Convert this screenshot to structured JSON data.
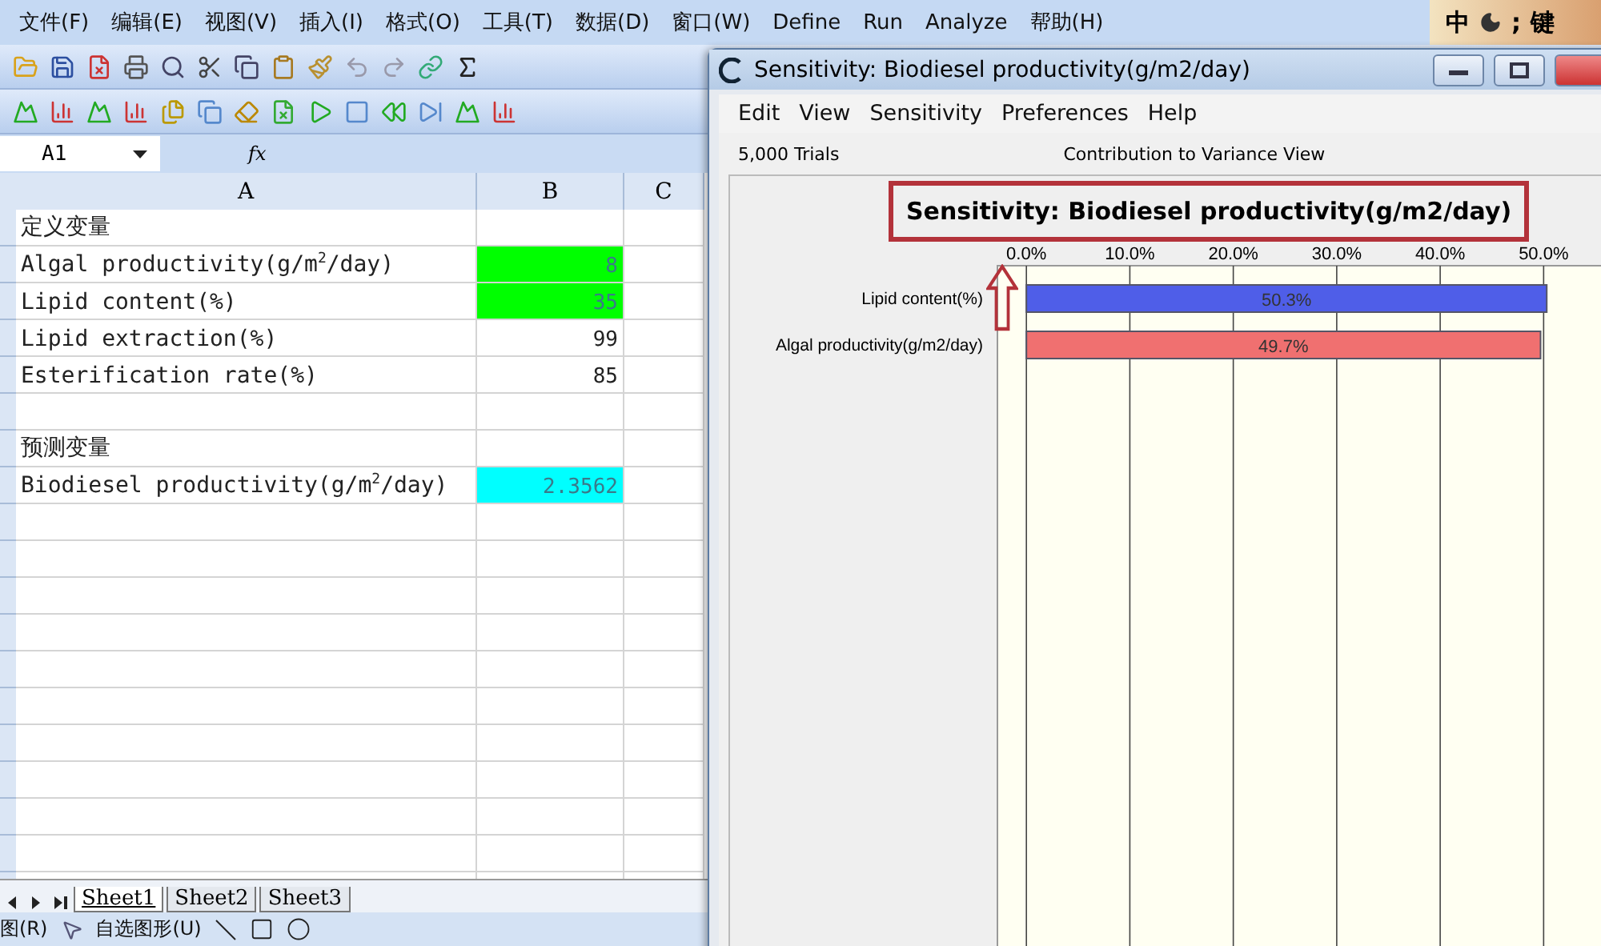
{
  "excel": {
    "menu": [
      "文件(F)",
      "编辑(E)",
      "视图(V)",
      "插入(I)",
      "格式(O)",
      "工具(T)",
      "数据(D)",
      "窗口(W)",
      "Define",
      "Run",
      "Analyze",
      "帮助(H)"
    ],
    "name_box": "A1",
    "formula_label": "fx",
    "columns": [
      "A",
      "B",
      "C"
    ],
    "rows": [
      {
        "a": "定义变量"
      },
      {
        "a": "Algal productivity(g/m$^{2}$/day)",
        "b": "8",
        "color": "#00ff00"
      },
      {
        "a": "Lipid content(%)",
        "b": "35",
        "color": "#00ff00"
      },
      {
        "a": "Lipid extraction(%)",
        "b": "99"
      },
      {
        "a": "Esterification rate(%)",
        "b": "85"
      },
      {},
      {
        "a": "预测变量"
      },
      {
        "a": "Biodiesel productivity(g/m$^{2}$/day)",
        "b": "2.3562",
        "color": "#00ffff"
      },
      {},
      {},
      {},
      {},
      {},
      {},
      {},
      {},
      {},
      {},
      {}
    ],
    "sheets": [
      {
        "label": "Sheet1",
        "selected": true
      },
      {
        "label": "Sheet2",
        "selected": false
      },
      {
        "label": "Sheet3",
        "selected": false
      }
    ],
    "draw_toolbar": [
      "图(R)",
      "自选图形(U)"
    ]
  },
  "ime": [
    "中",
    ";",
    "键"
  ],
  "sensitivity_window": {
    "title": "Sensitivity: Biodiesel productivity(g/m2/day)",
    "menu": [
      "Edit",
      "View",
      "Sensitivity",
      "Preferences",
      "Help"
    ],
    "trials": "5,000 Trials",
    "view": "Contribution to Variance View",
    "chart_data": {
      "type": "bar",
      "orientation": "horizontal",
      "title": "Sensitivity: Biodiesel productivity(g/m2/day)",
      "categories": [
        "Lipid content(%)",
        "Algal productivity(g/m2/day)"
      ],
      "series": [
        {
          "values": [
            50.3,
            49.7
          ]
        }
      ],
      "grid": true,
      "xlim": [
        -2.8,
        55.7
      ],
      "colors": [
        "#4f5ee8",
        "#f07070"
      ],
      "value_labels": [
        "50.3%",
        "49.7%"
      ],
      "xticks": [
        {
          "value": 0,
          "label": "0.0%"
        },
        {
          "value": 10,
          "label": "10.0%"
        },
        {
          "value": 20,
          "label": "20.0%"
        },
        {
          "value": 30,
          "label": "30.0%"
        },
        {
          "value": 40,
          "label": "40.0%"
        },
        {
          "value": 50,
          "label": "50.0%"
        }
      ]
    }
  }
}
